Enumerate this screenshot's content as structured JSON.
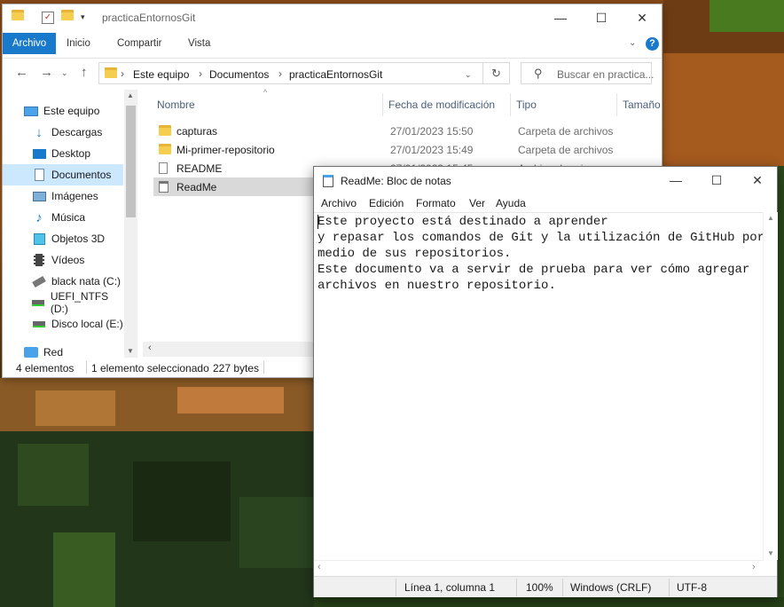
{
  "explorer": {
    "title": "practicaEntornosGit",
    "ribbon_tabs": [
      "Archivo",
      "Inicio",
      "Compartir",
      "Vista"
    ],
    "breadcrumb": [
      "Este equipo",
      "Documentos",
      "practicaEntornosGit"
    ],
    "search_placeholder": "Buscar en practica...",
    "columns": [
      "Nombre",
      "Fecha de modificación",
      "Tipo",
      "Tamaño"
    ],
    "nav_items": [
      {
        "label": "Este equipo",
        "icon": "computer-icon"
      },
      {
        "label": "Descargas",
        "icon": "download-icon"
      },
      {
        "label": "Desktop",
        "icon": "desktop-icon"
      },
      {
        "label": "Documentos",
        "icon": "document-icon",
        "selected": true
      },
      {
        "label": "Imágenes",
        "icon": "image-icon"
      },
      {
        "label": "Música",
        "icon": "music-icon"
      },
      {
        "label": "Objetos 3D",
        "icon": "cube-icon"
      },
      {
        "label": "Vídeos",
        "icon": "video-icon"
      },
      {
        "label": "black nata (C:)",
        "icon": "drive-icon"
      },
      {
        "label": "UEFI_NTFS (D:)",
        "icon": "drive-icon"
      },
      {
        "label": "Disco local (E:)",
        "icon": "drive-icon"
      },
      {
        "label": "Red",
        "icon": "network-icon"
      }
    ],
    "files": [
      {
        "name": "capturas",
        "date": "27/01/2023 15:50",
        "type": "Carpeta de archivos",
        "icon": "folder-icon"
      },
      {
        "name": "Mi-primer-repositorio",
        "date": "27/01/2023 15:49",
        "type": "Carpeta de archivos",
        "icon": "folder-icon"
      },
      {
        "name": "README",
        "date": "27/01/2023 15:45",
        "type": "Archivo de origen ...",
        "icon": "file-icon"
      },
      {
        "name": "ReadMe",
        "date": "",
        "type": "",
        "icon": "text-file-icon",
        "selected": true
      }
    ],
    "status": {
      "count": "4 elementos",
      "selection": "1 elemento seleccionado",
      "size": "227 bytes"
    }
  },
  "notepad": {
    "title": "ReadMe: Bloc de notas",
    "menu": [
      "Archivo",
      "Edición",
      "Formato",
      "Ver",
      "Ayuda"
    ],
    "lines": [
      "Este proyecto está destinado a aprender",
      "y repasar los comandos de Git y la utilización de GitHub por",
      "medio de sus repositorios.",
      "Este documento va a servir de prueba para ver cómo agregar",
      "archivos en nuestro repositorio."
    ],
    "status": {
      "position": "Línea 1, columna 1",
      "zoom": "100%",
      "line_ending": "Windows (CRLF)",
      "encoding": "UTF-8"
    }
  },
  "colors": {
    "accent": "#1979ca",
    "selection": "#cce8ff",
    "folder": "#f5cd4f"
  }
}
